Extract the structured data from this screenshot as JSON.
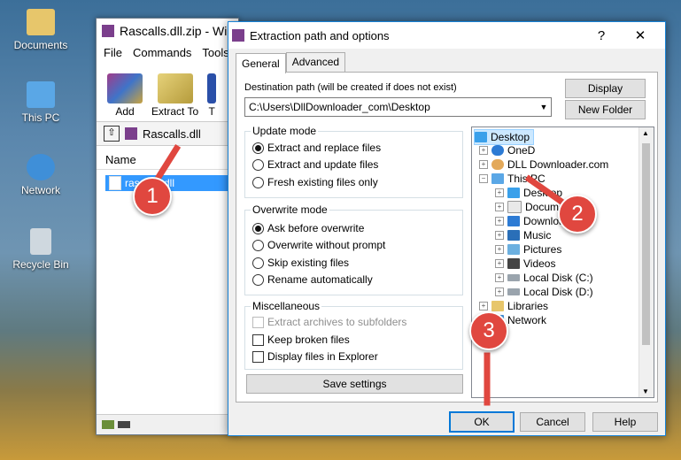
{
  "desktop": {
    "icons": [
      {
        "label": "Documents",
        "icon": "documents-icon",
        "color": "#e7c66b"
      },
      {
        "label": "This PC",
        "icon": "this-pc-icon",
        "color": "#5aa7e6"
      },
      {
        "label": "Network",
        "icon": "network-icon",
        "color": "#3f8fd8"
      },
      {
        "label": "Recycle Bin",
        "icon": "recycle-bin-icon",
        "color": "#cfd8df"
      }
    ]
  },
  "bg_window": {
    "title": "Rascalls.dll.zip - Wi",
    "menu": [
      "File",
      "Commands",
      "Tools"
    ],
    "toolbar": {
      "add": "Add",
      "extract": "Extract To",
      "next": "T"
    },
    "address": "Rascalls.dll",
    "column_name": "Name",
    "file": "rascalls.dll"
  },
  "dialog": {
    "title": "Extraction path and options",
    "help_btn": "?",
    "close_btn": "✕",
    "tabs": [
      "General",
      "Advanced"
    ],
    "dest_label": "Destination path (will be created if does not exist)",
    "dest_value": "C:\\Users\\DllDownloader_com\\Desktop",
    "display_btn": "Display",
    "new_folder_btn": "New Folder",
    "update_mode": {
      "title": "Update mode",
      "options": [
        "Extract and replace files",
        "Extract and update files",
        "Fresh existing files only"
      ]
    },
    "overwrite_mode": {
      "title": "Overwrite mode",
      "options": [
        "Ask before overwrite",
        "Overwrite without prompt",
        "Skip existing files",
        "Rename automatically"
      ]
    },
    "misc": {
      "title": "Miscellaneous",
      "options": [
        "Extract archives to subfolders",
        "Keep broken files",
        "Display files in Explorer"
      ]
    },
    "save_btn": "Save settings",
    "tree": [
      {
        "label": "Desktop",
        "icon": "desktop-icon"
      },
      {
        "label": "OneD",
        "icon": "onedrive-icon"
      },
      {
        "label": "DLL Downloader.com",
        "icon": "user-icon"
      },
      {
        "label": "This PC",
        "icon": "this-pc-icon"
      },
      {
        "label": "Desktop",
        "icon": "desktop-icon"
      },
      {
        "label": "Document",
        "icon": "documents-icon"
      },
      {
        "label": "Downloads",
        "icon": "downloads-icon"
      },
      {
        "label": "Music",
        "icon": "music-icon"
      },
      {
        "label": "Pictures",
        "icon": "pictures-icon"
      },
      {
        "label": "Videos",
        "icon": "videos-icon"
      },
      {
        "label": "Local Disk (C:)",
        "icon": "disk-icon"
      },
      {
        "label": "Local Disk (D:)",
        "icon": "disk-icon"
      },
      {
        "label": "Libraries",
        "icon": "libraries-icon"
      },
      {
        "label": "Network",
        "icon": "network-icon"
      }
    ],
    "ok_btn": "OK",
    "cancel_btn": "Cancel",
    "help_bottom_btn": "Help"
  },
  "markers": [
    "1",
    "2",
    "3"
  ],
  "colors": {
    "accent": "#0078d7",
    "selection": "#3399ff",
    "marker": "#e0473f"
  }
}
